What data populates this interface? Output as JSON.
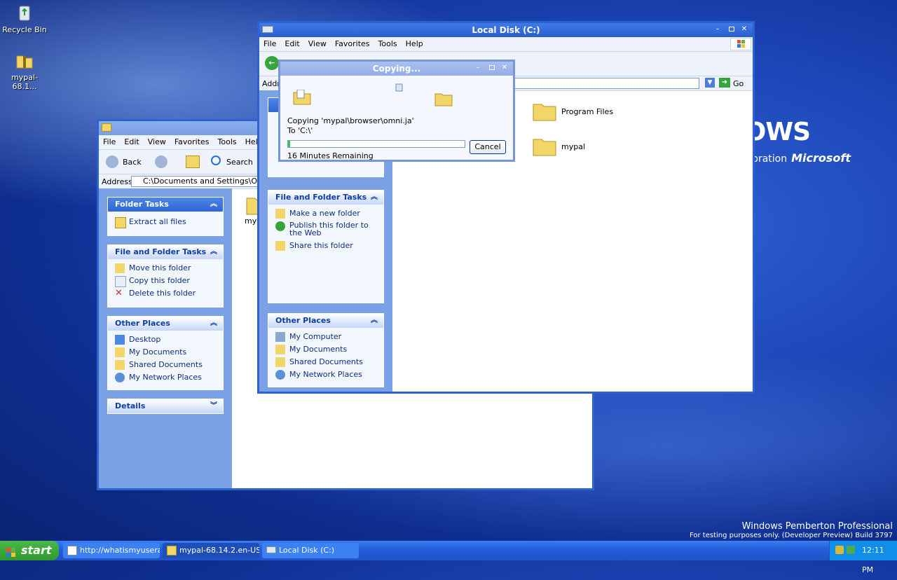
{
  "desktop": {
    "icons": [
      {
        "label": "Recycle Bin",
        "icon": "recycle-bin-icon"
      },
      {
        "label": "mypal-68.1...",
        "icon": "zip-folder-icon"
      }
    ],
    "brand_main": "OWS",
    "brand_sub": "oration",
    "brand_company": "Microsoft",
    "watermark_line1": "Windows Pemberton Professional",
    "watermark_line2": "For testing purposes only. (Developer Preview) Build 3797"
  },
  "back_window": {
    "menu": [
      "File",
      "Edit",
      "View",
      "Favorites",
      "Tools",
      "Help"
    ],
    "toolbar": {
      "back": "Back",
      "search": "Search"
    },
    "address_label": "Address",
    "address_value": "C:\\Documents and Settings\\Owner\\De",
    "panels": {
      "folder_tasks": {
        "title": "Folder Tasks",
        "items": [
          "Extract all files"
        ]
      },
      "file_tasks": {
        "title": "File and Folder Tasks",
        "items": [
          "Move this folder",
          "Copy this folder",
          "Delete this folder"
        ]
      },
      "other_places": {
        "title": "Other Places",
        "items": [
          "Desktop",
          "My Documents",
          "Shared Documents",
          "My Network Places"
        ]
      },
      "details": {
        "title": "Details"
      }
    },
    "file_label": "myp"
  },
  "front_window": {
    "title": "Local Disk (C:)",
    "menu": [
      "File",
      "Edit",
      "View",
      "Favorites",
      "Tools",
      "Help"
    ],
    "address_label": "Addr",
    "go_label": "Go",
    "panels": {
      "file_tasks": {
        "title": "File and Folder Tasks",
        "items": [
          "Make a new folder",
          "Publish this folder to the Web",
          "Share this folder"
        ]
      },
      "other_places": {
        "title": "Other Places",
        "items": [
          "My Computer",
          "My Documents",
          "Shared Documents",
          "My Network Places"
        ]
      }
    },
    "folders": [
      "Program Files",
      "mypal"
    ]
  },
  "copy_dialog": {
    "title": "Copying...",
    "line1": "Copying 'mypal\\browser\\omni.ja'",
    "line2": "To 'C:\\'",
    "remaining": "16 Minutes Remaining",
    "cancel": "Cancel",
    "progress": 0.01
  },
  "taskbar": {
    "start": "start",
    "tasks": [
      {
        "label": "http://whatismyusera...",
        "active": false
      },
      {
        "label": "mypal-68.14.2.en-US....",
        "active": true
      },
      {
        "label": "Local Disk (C:)",
        "active": false
      }
    ],
    "clock": "12:11 PM"
  },
  "colors": {
    "accent": "#2d63cf",
    "desktop": "#1d47b8",
    "taskbar": "#245edb",
    "start": "#2f9a2f"
  }
}
